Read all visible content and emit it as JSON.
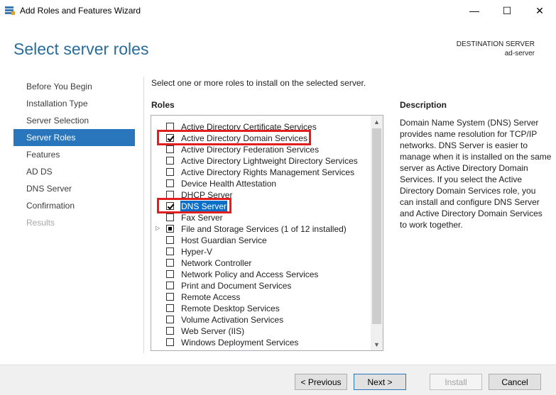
{
  "window": {
    "title": "Add Roles and Features Wizard",
    "minimize": "—",
    "maximize": "☐",
    "close": "✕"
  },
  "page": {
    "heading": "Select server roles",
    "destination_label": "DESTINATION SERVER",
    "destination_server": "ad-server"
  },
  "nav": {
    "items": [
      {
        "label": "Before You Begin",
        "state": "normal"
      },
      {
        "label": "Installation Type",
        "state": "normal"
      },
      {
        "label": "Server Selection",
        "state": "normal"
      },
      {
        "label": "Server Roles",
        "state": "active"
      },
      {
        "label": "Features",
        "state": "normal"
      },
      {
        "label": "AD DS",
        "state": "normal"
      },
      {
        "label": "DNS Server",
        "state": "normal"
      },
      {
        "label": "Confirmation",
        "state": "normal"
      },
      {
        "label": "Results",
        "state": "disabled"
      }
    ]
  },
  "main": {
    "intro": "Select one or more roles to install on the selected server.",
    "roles_label": "Roles",
    "roles": [
      {
        "label": "Active Directory Certificate Services",
        "checked": false
      },
      {
        "label": "Active Directory Domain Services",
        "checked": true
      },
      {
        "label": "Active Directory Federation Services",
        "checked": false
      },
      {
        "label": "Active Directory Lightweight Directory Services",
        "checked": false
      },
      {
        "label": "Active Directory Rights Management Services",
        "checked": false
      },
      {
        "label": "Device Health Attestation",
        "checked": false
      },
      {
        "label": "DHCP Server",
        "checked": false
      },
      {
        "label": "DNS Server",
        "checked": true
      },
      {
        "label": "Fax Server",
        "checked": false
      },
      {
        "label": "File and Storage Services (1 of 12 installed)",
        "checked": "partial"
      },
      {
        "label": "Host Guardian Service",
        "checked": false
      },
      {
        "label": "Hyper-V",
        "checked": false
      },
      {
        "label": "Network Controller",
        "checked": false
      },
      {
        "label": "Network Policy and Access Services",
        "checked": false
      },
      {
        "label": "Print and Document Services",
        "checked": false
      },
      {
        "label": "Remote Access",
        "checked": false
      },
      {
        "label": "Remote Desktop Services",
        "checked": false
      },
      {
        "label": "Volume Activation Services",
        "checked": false
      },
      {
        "label": "Web Server (IIS)",
        "checked": false
      },
      {
        "label": "Windows Deployment Services",
        "checked": false
      }
    ],
    "description_label": "Description",
    "description": "Domain Name System (DNS) Server provides name resolution for TCP/IP networks. DNS Server is easier to manage when it is installed on the same server as Active Directory Domain Services. If you select the Active Directory Domain Services role, you can install and configure DNS Server and Active Directory Domain Services to work together."
  },
  "footer": {
    "previous": "< Previous",
    "next": "Next >",
    "install": "Install",
    "cancel": "Cancel"
  },
  "colors": {
    "accent": "#2a76bc",
    "heading": "#2a6c99",
    "annotation": "#e02020",
    "selection": "#0b6fc9"
  }
}
